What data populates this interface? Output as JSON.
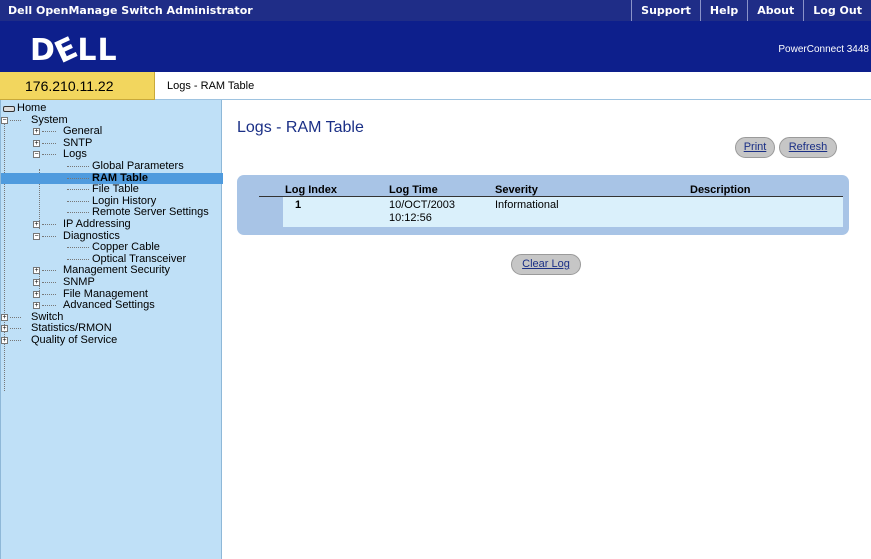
{
  "app": {
    "title": "Dell OpenManage Switch Administrator",
    "menu": [
      "Support",
      "Help",
      "About",
      "Log Out"
    ]
  },
  "banner": {
    "logo": "DELL",
    "product": "PowerConnect 3448"
  },
  "address": {
    "ip": "176.210.11.22",
    "breadcrumb": "Logs - RAM Table"
  },
  "sidebar": {
    "home": "Home",
    "system": "System",
    "general": "General",
    "sntp": "SNTP",
    "logs": "Logs",
    "global_parameters": "Global Parameters",
    "ram_table": "RAM Table",
    "file_table": "File Table",
    "login_history": "Login History",
    "remote_server_settings": "Remote Server Settings",
    "ip_addressing": "IP Addressing",
    "diagnostics": "Diagnostics",
    "copper_cable": "Copper Cable",
    "optical_transceiver": "Optical Transceiver",
    "management_security": "Management Security",
    "snmp": "SNMP",
    "file_management": "File Management",
    "advanced_settings": "Advanced Settings",
    "switch": "Switch",
    "statistics_rmon": "Statistics/RMON",
    "quality_of_service": "Quality of Service"
  },
  "main": {
    "title": "Logs - RAM Table",
    "print_label": "Print",
    "refresh_label": "Refresh",
    "clear_label": "Clear Log",
    "columns": {
      "log_index": "Log Index",
      "log_time": "Log Time",
      "severity": "Severity",
      "description": "Description"
    },
    "rows": [
      {
        "log_index": "1",
        "log_time_date": "10/OCT/2003",
        "log_time_clock": "10:12:56",
        "severity": "Informational",
        "description": ""
      }
    ]
  },
  "colors": {
    "topbar": "#1f2d87",
    "banner": "#0d1f8c",
    "ip_box": "#f2d65e",
    "sidebar": "#bfe0f7",
    "selection": "#4f9bde",
    "table_panel": "#a8c4e6",
    "row": "#daf0fb"
  }
}
